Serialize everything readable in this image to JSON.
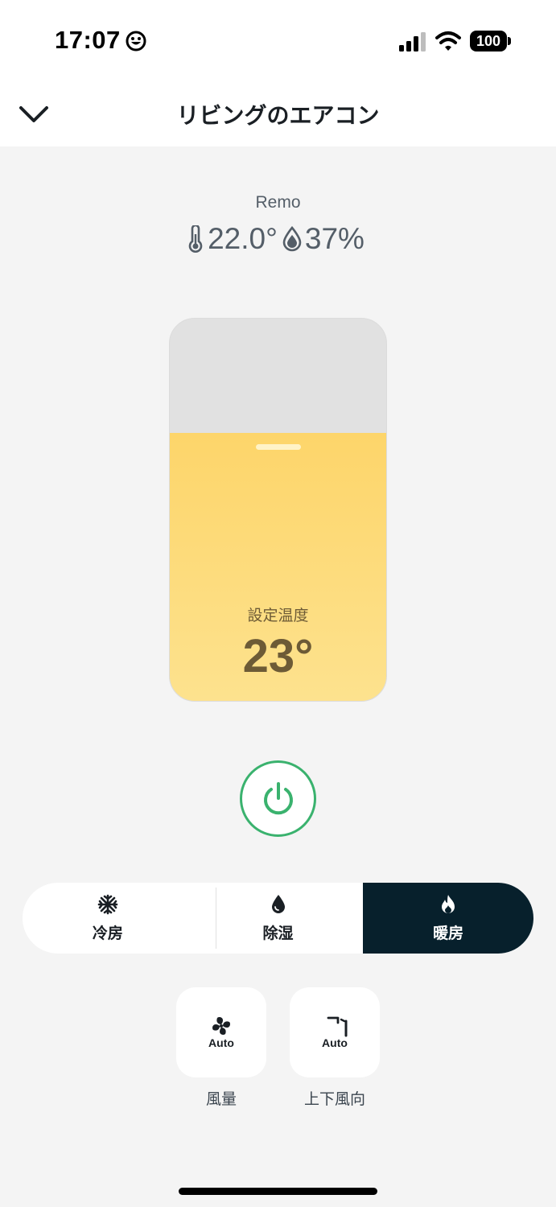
{
  "status_bar": {
    "time": "17:07",
    "emoji": "smiley-face-icon",
    "battery": "100"
  },
  "nav": {
    "title": "リビングのエアコン",
    "back_icon": "chevron-down-icon"
  },
  "sensor": {
    "device_name": "Remo",
    "temperature": "22.0°",
    "humidity": "37%"
  },
  "setpoint": {
    "label": "設定温度",
    "value": "23°",
    "level_fraction": 0.7
  },
  "power": {
    "icon": "power-icon",
    "color": "#3ab26e"
  },
  "modes": [
    {
      "label": "冷房",
      "icon": "snowflake-icon",
      "active": false
    },
    {
      "label": "除湿",
      "icon": "droplet-icon",
      "active": false
    },
    {
      "label": "暖房",
      "icon": "flame-icon",
      "active": true
    }
  ],
  "options": [
    {
      "value": "Auto",
      "label": "風量",
      "icon": "fan-icon"
    },
    {
      "value": "Auto",
      "label": "上下風向",
      "icon": "vertical-swing-icon"
    }
  ],
  "colors": {
    "accent_heat": "#fdd56a",
    "active_mode_bg": "#07202c",
    "power_green": "#3ab26e"
  }
}
